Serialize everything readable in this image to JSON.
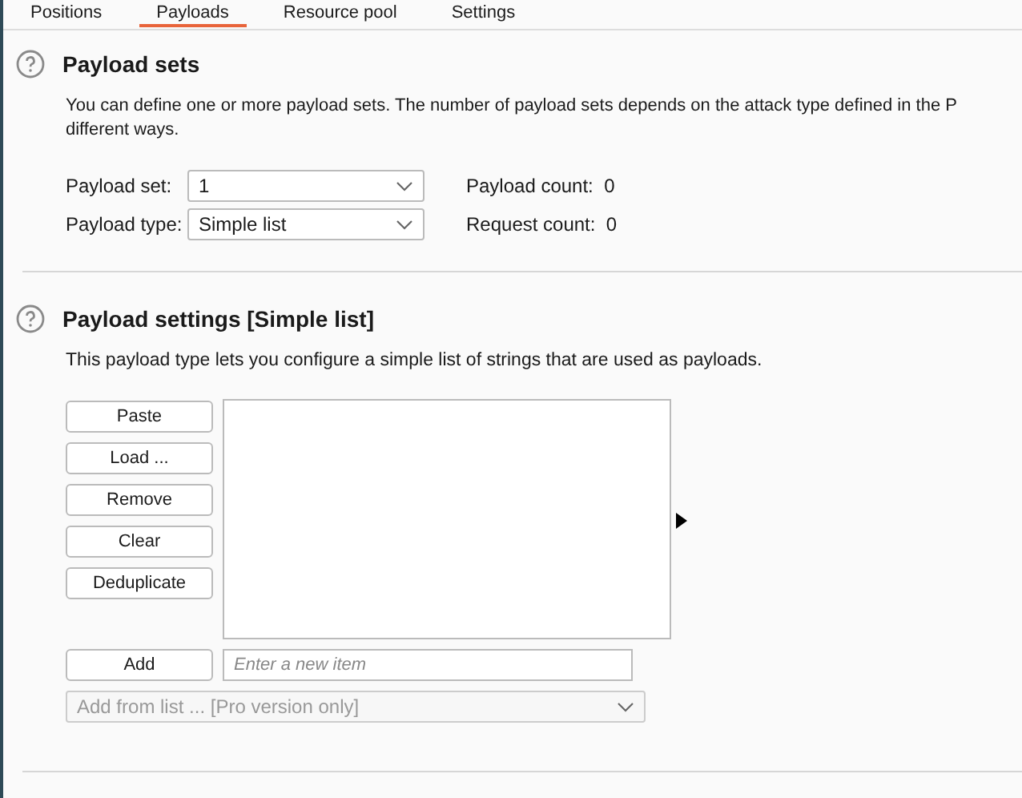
{
  "tabs": [
    {
      "label": "Positions",
      "selected": false
    },
    {
      "label": "Payloads",
      "selected": true
    },
    {
      "label": "Resource pool",
      "selected": false
    },
    {
      "label": "Settings",
      "selected": false
    }
  ],
  "payload_sets": {
    "title": "Payload sets",
    "description_lines": [
      "You can define one or more payload sets. The number of payload sets depends on the attack type defined in the P",
      "different ways."
    ],
    "fields": [
      {
        "label": "Payload set:",
        "value": "1",
        "info_label": "Payload count:",
        "info_value": "0"
      },
      {
        "label": "Payload type:",
        "value": "Simple list",
        "info_label": "Request count:",
        "info_value": "0"
      }
    ]
  },
  "payload_settings": {
    "title": "Payload settings [Simple list]",
    "description": "This payload type lets you configure a simple list of strings that are used as payloads.",
    "buttons": [
      "Paste",
      "Load ...",
      "Remove",
      "Clear",
      "Deduplicate"
    ],
    "add_button": "Add",
    "new_item": {
      "placeholder": "Enter a new item"
    },
    "add_from_list": {
      "value": "Add from list ... [Pro version only]",
      "disabled": true
    }
  }
}
